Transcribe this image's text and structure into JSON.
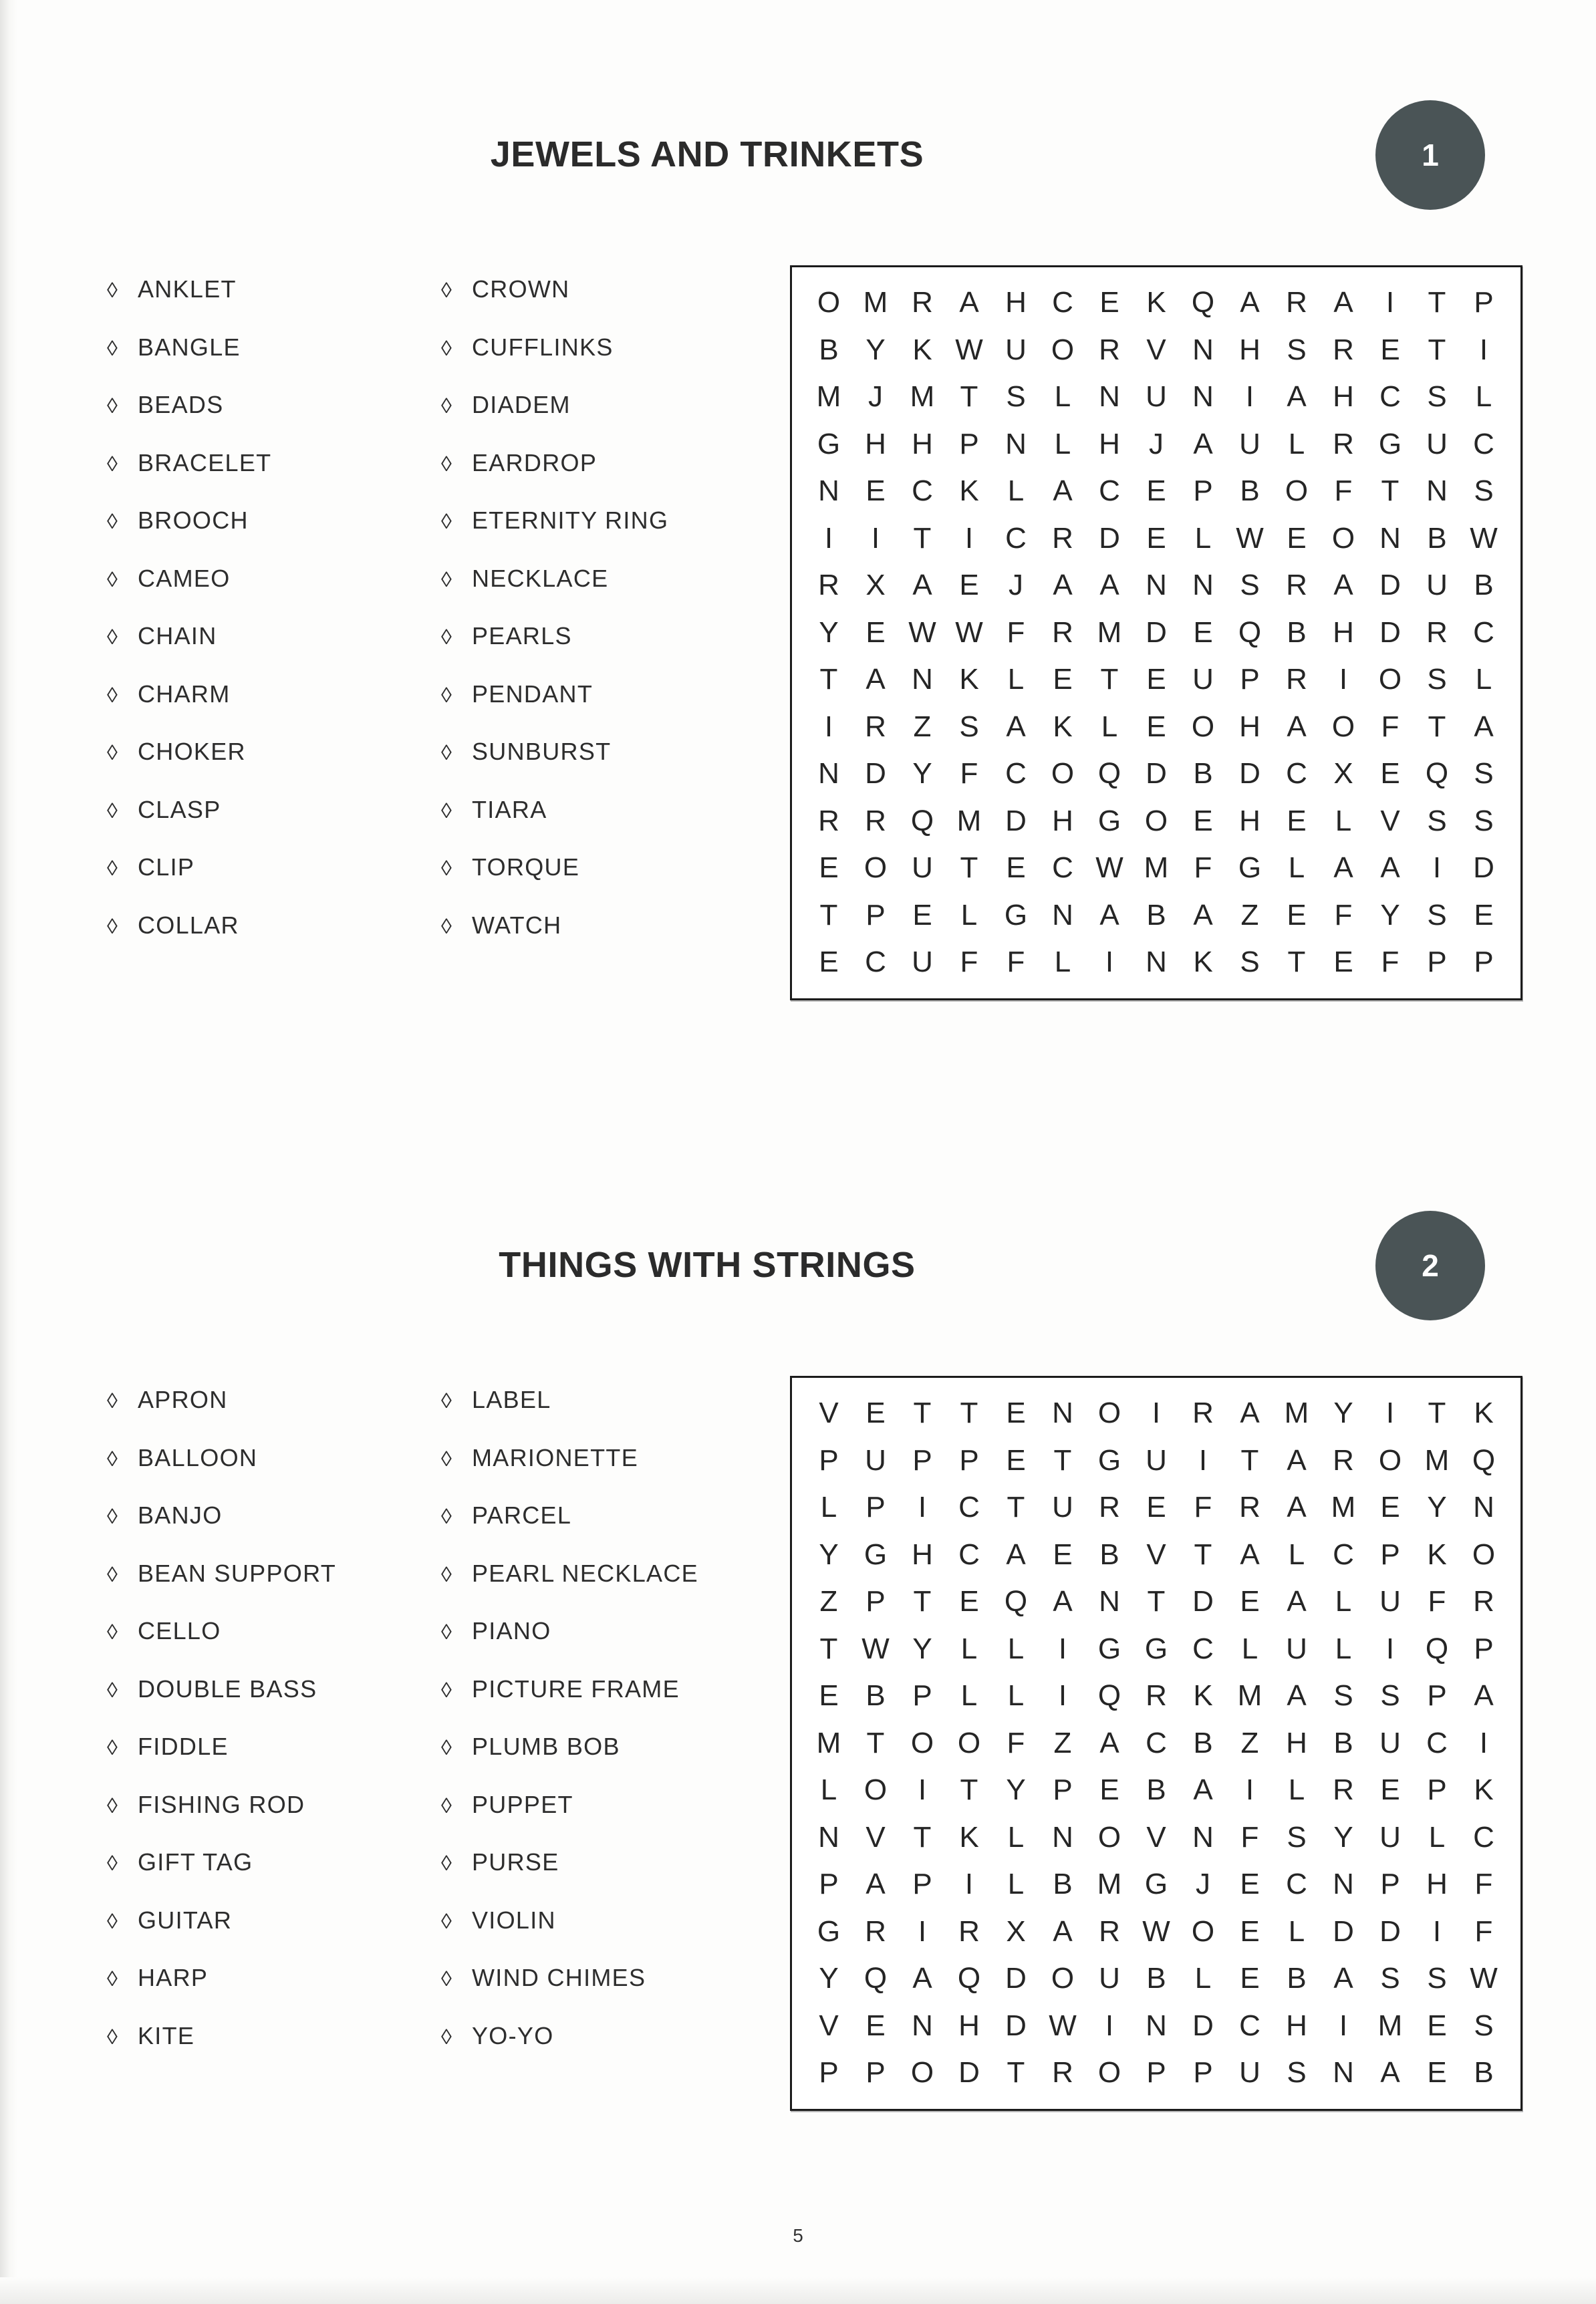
{
  "page": {
    "page_number": "5",
    "bullet_glyph": "◊",
    "badge_color": "#4a5456",
    "text_color": "#2d2d2d"
  },
  "puzzles": [
    {
      "number": "1",
      "title": "JEWELS AND TRINKETS",
      "word_columns": [
        [
          "ANKLET",
          "BANGLE",
          "BEADS",
          "BRACELET",
          "BROOCH",
          "CAMEO",
          "CHAIN",
          "CHARM",
          "CHOKER",
          "CLASP",
          "CLIP",
          "COLLAR"
        ],
        [
          "CROWN",
          "CUFFLINKS",
          "DIADEM",
          "EARDROP",
          "ETERNITY RING",
          "NECKLACE",
          "PEARLS",
          "PENDANT",
          "SUNBURST",
          "TIARA",
          "TORQUE",
          "WATCH"
        ]
      ],
      "grid": [
        [
          "O",
          "M",
          "R",
          "A",
          "H",
          "C",
          "E",
          "K",
          "Q",
          "A",
          "R",
          "A",
          "I",
          "T",
          "P"
        ],
        [
          "B",
          "Y",
          "K",
          "W",
          "U",
          "O",
          "R",
          "V",
          "N",
          "H",
          "S",
          "R",
          "E",
          "T",
          "I"
        ],
        [
          "M",
          "J",
          "M",
          "T",
          "S",
          "L",
          "N",
          "U",
          "N",
          "I",
          "A",
          "H",
          "C",
          "S",
          "L"
        ],
        [
          "G",
          "H",
          "H",
          "P",
          "N",
          "L",
          "H",
          "J",
          "A",
          "U",
          "L",
          "R",
          "G",
          "U",
          "C"
        ],
        [
          "N",
          "E",
          "C",
          "K",
          "L",
          "A",
          "C",
          "E",
          "P",
          "B",
          "O",
          "F",
          "T",
          "N",
          "S"
        ],
        [
          "I",
          "I",
          "T",
          "I",
          "C",
          "R",
          "D",
          "E",
          "L",
          "W",
          "E",
          "O",
          "N",
          "B",
          "W"
        ],
        [
          "R",
          "X",
          "A",
          "E",
          "J",
          "A",
          "A",
          "N",
          "N",
          "S",
          "R",
          "A",
          "D",
          "U",
          "B"
        ],
        [
          "Y",
          "E",
          "W",
          "W",
          "F",
          "R",
          "M",
          "D",
          "E",
          "Q",
          "B",
          "H",
          "D",
          "R",
          "C"
        ],
        [
          "T",
          "A",
          "N",
          "K",
          "L",
          "E",
          "T",
          "E",
          "U",
          "P",
          "R",
          "I",
          "O",
          "S",
          "L"
        ],
        [
          "I",
          "R",
          "Z",
          "S",
          "A",
          "K",
          "L",
          "E",
          "O",
          "H",
          "A",
          "O",
          "F",
          "T",
          "A"
        ],
        [
          "N",
          "D",
          "Y",
          "F",
          "C",
          "O",
          "Q",
          "D",
          "B",
          "D",
          "C",
          "X",
          "E",
          "Q",
          "S"
        ],
        [
          "R",
          "R",
          "Q",
          "M",
          "D",
          "H",
          "G",
          "O",
          "E",
          "H",
          "E",
          "L",
          "V",
          "S",
          "S"
        ],
        [
          "E",
          "O",
          "U",
          "T",
          "E",
          "C",
          "W",
          "M",
          "F",
          "G",
          "L",
          "A",
          "A",
          "I",
          "D"
        ],
        [
          "T",
          "P",
          "E",
          "L",
          "G",
          "N",
          "A",
          "B",
          "A",
          "Z",
          "E",
          "F",
          "Y",
          "S",
          "E"
        ],
        [
          "E",
          "C",
          "U",
          "F",
          "F",
          "L",
          "I",
          "N",
          "K",
          "S",
          "T",
          "E",
          "F",
          "P",
          "P"
        ]
      ]
    },
    {
      "number": "2",
      "title": "THINGS WITH STRINGS",
      "word_columns": [
        [
          "APRON",
          "BALLOON",
          "BANJO",
          "BEAN SUPPORT",
          "CELLO",
          "DOUBLE BASS",
          "FIDDLE",
          "FISHING ROD",
          "GIFT TAG",
          "GUITAR",
          "HARP",
          "KITE"
        ],
        [
          "LABEL",
          "MARIONETTE",
          "PARCEL",
          "PEARL NECKLACE",
          "PIANO",
          "PICTURE FRAME",
          "PLUMB BOB",
          "PUPPET",
          "PURSE",
          "VIOLIN",
          "WIND CHIMES",
          "YO-YO"
        ]
      ],
      "grid": [
        [
          "V",
          "E",
          "T",
          "T",
          "E",
          "N",
          "O",
          "I",
          "R",
          "A",
          "M",
          "Y",
          "I",
          "T",
          "K"
        ],
        [
          "P",
          "U",
          "P",
          "P",
          "E",
          "T",
          "G",
          "U",
          "I",
          "T",
          "A",
          "R",
          "O",
          "M",
          "Q"
        ],
        [
          "L",
          "P",
          "I",
          "C",
          "T",
          "U",
          "R",
          "E",
          "F",
          "R",
          "A",
          "M",
          "E",
          "Y",
          "N"
        ],
        [
          "Y",
          "G",
          "H",
          "C",
          "A",
          "E",
          "B",
          "V",
          "T",
          "A",
          "L",
          "C",
          "P",
          "K",
          "O"
        ],
        [
          "Z",
          "P",
          "T",
          "E",
          "Q",
          "A",
          "N",
          "T",
          "D",
          "E",
          "A",
          "L",
          "U",
          "F",
          "R"
        ],
        [
          "T",
          "W",
          "Y",
          "L",
          "L",
          "I",
          "G",
          "G",
          "C",
          "L",
          "U",
          "L",
          "I",
          "Q",
          "P"
        ],
        [
          "E",
          "B",
          "P",
          "L",
          "L",
          "I",
          "Q",
          "R",
          "K",
          "M",
          "A",
          "S",
          "S",
          "P",
          "A"
        ],
        [
          "M",
          "T",
          "O",
          "O",
          "F",
          "Z",
          "A",
          "C",
          "B",
          "Z",
          "H",
          "B",
          "U",
          "C",
          "I"
        ],
        [
          "L",
          "O",
          "I",
          "T",
          "Y",
          "P",
          "E",
          "B",
          "A",
          "I",
          "L",
          "R",
          "E",
          "P",
          "K"
        ],
        [
          "N",
          "V",
          "T",
          "K",
          "L",
          "N",
          "O",
          "V",
          "N",
          "F",
          "S",
          "Y",
          "U",
          "L",
          "C"
        ],
        [
          "P",
          "A",
          "P",
          "I",
          "L",
          "B",
          "M",
          "G",
          "J",
          "E",
          "C",
          "N",
          "P",
          "H",
          "F"
        ],
        [
          "G",
          "R",
          "I",
          "R",
          "X",
          "A",
          "R",
          "W",
          "O",
          "E",
          "L",
          "D",
          "D",
          "I",
          "F"
        ],
        [
          "Y",
          "Q",
          "A",
          "Q",
          "D",
          "O",
          "U",
          "B",
          "L",
          "E",
          "B",
          "A",
          "S",
          "S",
          "W"
        ],
        [
          "V",
          "E",
          "N",
          "H",
          "D",
          "W",
          "I",
          "N",
          "D",
          "C",
          "H",
          "I",
          "M",
          "E",
          "S"
        ],
        [
          "P",
          "P",
          "O",
          "D",
          "T",
          "R",
          "O",
          "P",
          "P",
          "U",
          "S",
          "N",
          "A",
          "E",
          "B"
        ]
      ]
    }
  ]
}
